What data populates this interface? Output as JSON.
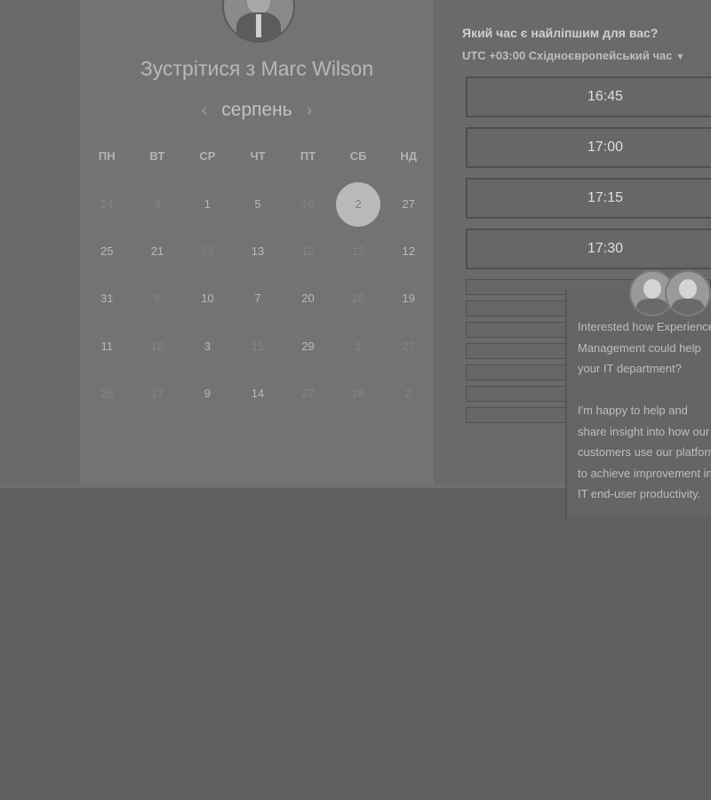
{
  "booking": {
    "title": "Зустрітися з Marc Wilson",
    "month": "серпень",
    "prev_icon": "chevron-left-icon",
    "next_icon": "chevron-right-icon",
    "weekdays": [
      "ПН",
      "ВТ",
      "СР",
      "ЧТ",
      "ПТ",
      "СБ",
      "НД"
    ],
    "weeks": [
      [
        "24",
        "4",
        "1",
        "5",
        "16",
        "2",
        "27"
      ],
      [
        "25",
        "21",
        "22",
        "13",
        "12",
        "12",
        "12"
      ],
      [
        "31",
        "8",
        "10",
        "7",
        "20",
        "26",
        "19"
      ],
      [
        "11",
        "18",
        "3",
        "15",
        "29",
        "1",
        "27"
      ],
      [
        "26",
        "17",
        "9",
        "14",
        "27",
        "28",
        "2"
      ]
    ]
  },
  "times": {
    "question": "Який час є найліпшим для вас?",
    "timezone": "UTC +03:00 Східноєвропейський час",
    "slots": [
      "16:45",
      "17:00",
      "17:15",
      "17:30"
    ]
  },
  "chat": {
    "message": "Interested how Experience Management could help your IT department?\n\nI'm happy to help and share insight into how our customers use our platform to achieve improvement in IT end-user productivity."
  },
  "colors": {
    "selected_day": "#b9b9b9",
    "background": "#5f5f5f"
  }
}
